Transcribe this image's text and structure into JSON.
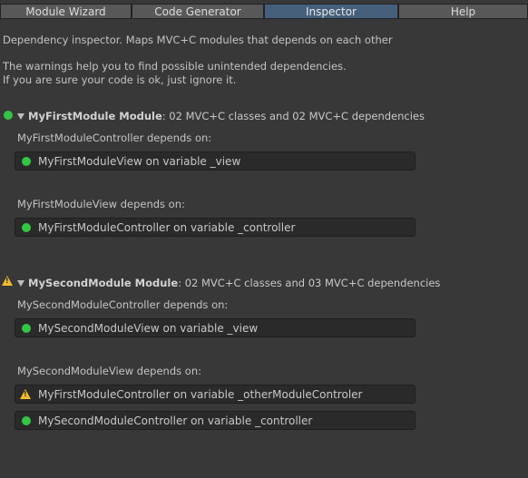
{
  "tabs": [
    "Module Wizard",
    "Code Generator",
    "Inspector",
    "Help"
  ],
  "active_tab": "Inspector",
  "description": {
    "line1": "Dependency inspector. Maps MVC+C modules that depends on each other",
    "line2": "The warnings help you to find possible unintended dependencies.",
    "line3": "If you are sure your code is ok, just ignore it."
  },
  "colors": {
    "ok": "#34c544",
    "warning": "#f3bb2d",
    "active_tab": "#46607c"
  },
  "modules": [
    {
      "name": "MyFirstModule Module",
      "summary": ": 02 MVC+C classes and 02 MVC+C dependencies",
      "status_icon": "green-dot-icon",
      "groups": [
        {
          "title": "MyFirstModuleController depends on:",
          "deps": [
            {
              "text": "MyFirstModuleView on variable _view",
              "status_icon": "green-dot-icon"
            }
          ]
        },
        {
          "title": "MyFirstModuleView depends on:",
          "deps": [
            {
              "text": "MyFirstModuleController on variable _controller",
              "status_icon": "green-dot-icon"
            }
          ]
        }
      ]
    },
    {
      "name": "MySecondModule Module",
      "summary": ": 02 MVC+C classes and 03 MVC+C dependencies",
      "status_icon": "warning-icon",
      "groups": [
        {
          "title": "MySecondModuleController depends on:",
          "deps": [
            {
              "text": "MySecondModuleView on variable _view",
              "status_icon": "green-dot-icon"
            }
          ]
        },
        {
          "title": "MySecondModuleView depends on:",
          "deps": [
            {
              "text": "MyFirstModuleController on variable _otherModuleControler",
              "status_icon": "warning-icon"
            },
            {
              "text": "MySecondModuleController on variable _controller",
              "status_icon": "green-dot-icon"
            }
          ]
        }
      ]
    }
  ]
}
